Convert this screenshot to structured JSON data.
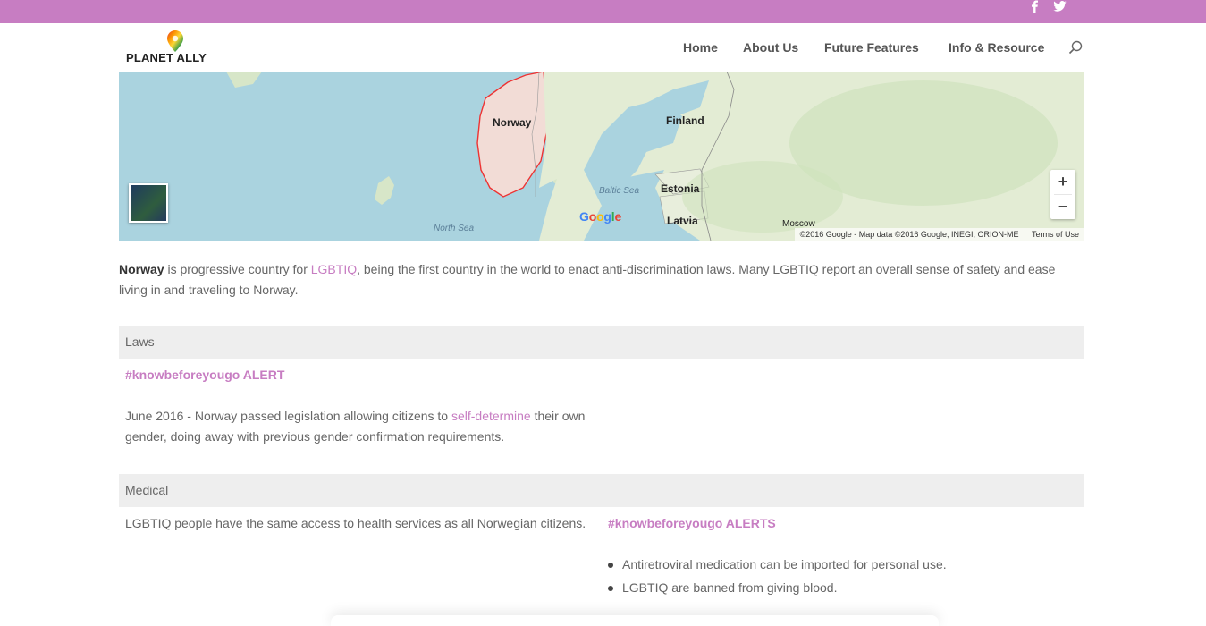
{
  "topbar": {
    "facebook_icon": "facebook-icon",
    "twitter_icon": "twitter-icon",
    "color": "#c77dc2"
  },
  "header": {
    "logo_text": "PLANET ALLY",
    "nav": [
      "Home",
      "About Us",
      "Future Features",
      "Info & Resource"
    ]
  },
  "map": {
    "labels": {
      "norway": "Norway",
      "finland": "Finland",
      "estonia": "Estonia",
      "latvia": "Latvia",
      "moscow": "Moscow",
      "baltic_sea": "Baltic Sea",
      "north_sea": "North Sea"
    },
    "google": "Google",
    "attribution": "©2016 Google - Map data ©2016 Google, INEGI, ORION-ME",
    "terms": "Terms of Use",
    "zoom_in": "+",
    "zoom_out": "−"
  },
  "intro": {
    "country": "Norway",
    "text1": " is progressive country for ",
    "link": "LGBTIQ",
    "text2": ", being the first country in the world to enact anti-discrimination laws. Many LGBTIQ report an overall sense of safety and ease living in and traveling to Norway."
  },
  "laws": {
    "heading": "Laws",
    "alert_title": "#knowbeforeyougo ALERT",
    "text_before": "June 2016 - Norway passed legislation allowing citizens to ",
    "link": "self-determine",
    "text_after": " their own gender, doing away with previous gender confirmation requirements."
  },
  "medical": {
    "heading": "Medical",
    "text": "LGBTIQ people have the same access to health services as all Norwegian citizens.",
    "alert_title": "#knowbeforeyougo ALERTS",
    "alerts": [
      "Antiretroviral medication can be imported for personal use.",
      "LGBTIQ are banned from giving blood."
    ]
  },
  "colors": {
    "accent": "#c77dc2",
    "row_bg": "#eeeeee",
    "water": "#aad3df",
    "land": "#e8eedc"
  }
}
